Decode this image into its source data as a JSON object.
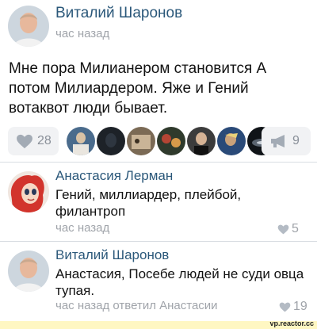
{
  "post": {
    "author": "Виталий Шаронов",
    "time": "час назад",
    "text": "Мне пора Милианером становится А потом Милиардером. Яже и Гений вотаквот люди бывает.",
    "likes": "28",
    "shares": "9"
  },
  "likers": [
    {
      "name": "liker-1",
      "color": "#4a6b8c"
    },
    {
      "name": "liker-2",
      "color": "#1d2228"
    },
    {
      "name": "liker-3",
      "color": "#7b6a55"
    },
    {
      "name": "liker-4",
      "color": "#2f3a2c"
    },
    {
      "name": "liker-5",
      "color": "#3c3c3c"
    },
    {
      "name": "liker-6",
      "color": "#2a4a78"
    },
    {
      "name": "liker-7",
      "color": "#101418"
    }
  ],
  "comments": [
    {
      "author": "Анастасия Лерман",
      "text": "Гений, миллиардер, плейбой, филантроп",
      "meta": "час назад",
      "likes": "5"
    },
    {
      "author": "Виталий Шаронов",
      "text": "Анастасия, Посебе людей не суди овца тупая.",
      "meta": "час назад ответил Анастасии",
      "likes": "19"
    }
  ],
  "watermark": "vp.reactor.cc"
}
